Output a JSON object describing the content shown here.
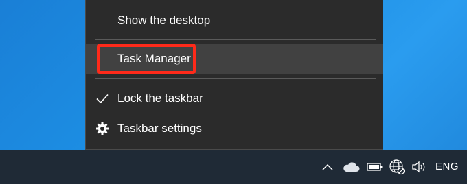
{
  "context_menu": {
    "items": [
      {
        "label": "Show the desktop",
        "icon": ""
      },
      {
        "label": "Task Manager",
        "icon": "",
        "highlighted": true
      },
      {
        "label": "Lock the taskbar",
        "icon": "check-icon",
        "checked": true
      },
      {
        "label": "Taskbar settings",
        "icon": "gear-icon"
      }
    ]
  },
  "annotation": {
    "highlight_color": "#ff2a1a"
  },
  "taskbar": {
    "tray_icons": [
      "chevron-up-icon",
      "onedrive-cloud-icon",
      "battery-icon",
      "network-globe-icon",
      "volume-icon"
    ],
    "language": "ENG"
  },
  "colors": {
    "menu_background": "#2b2b2b",
    "menu_hover": "#414141",
    "taskbar": "#1f2a36",
    "desktop": "#1d8fe4"
  }
}
